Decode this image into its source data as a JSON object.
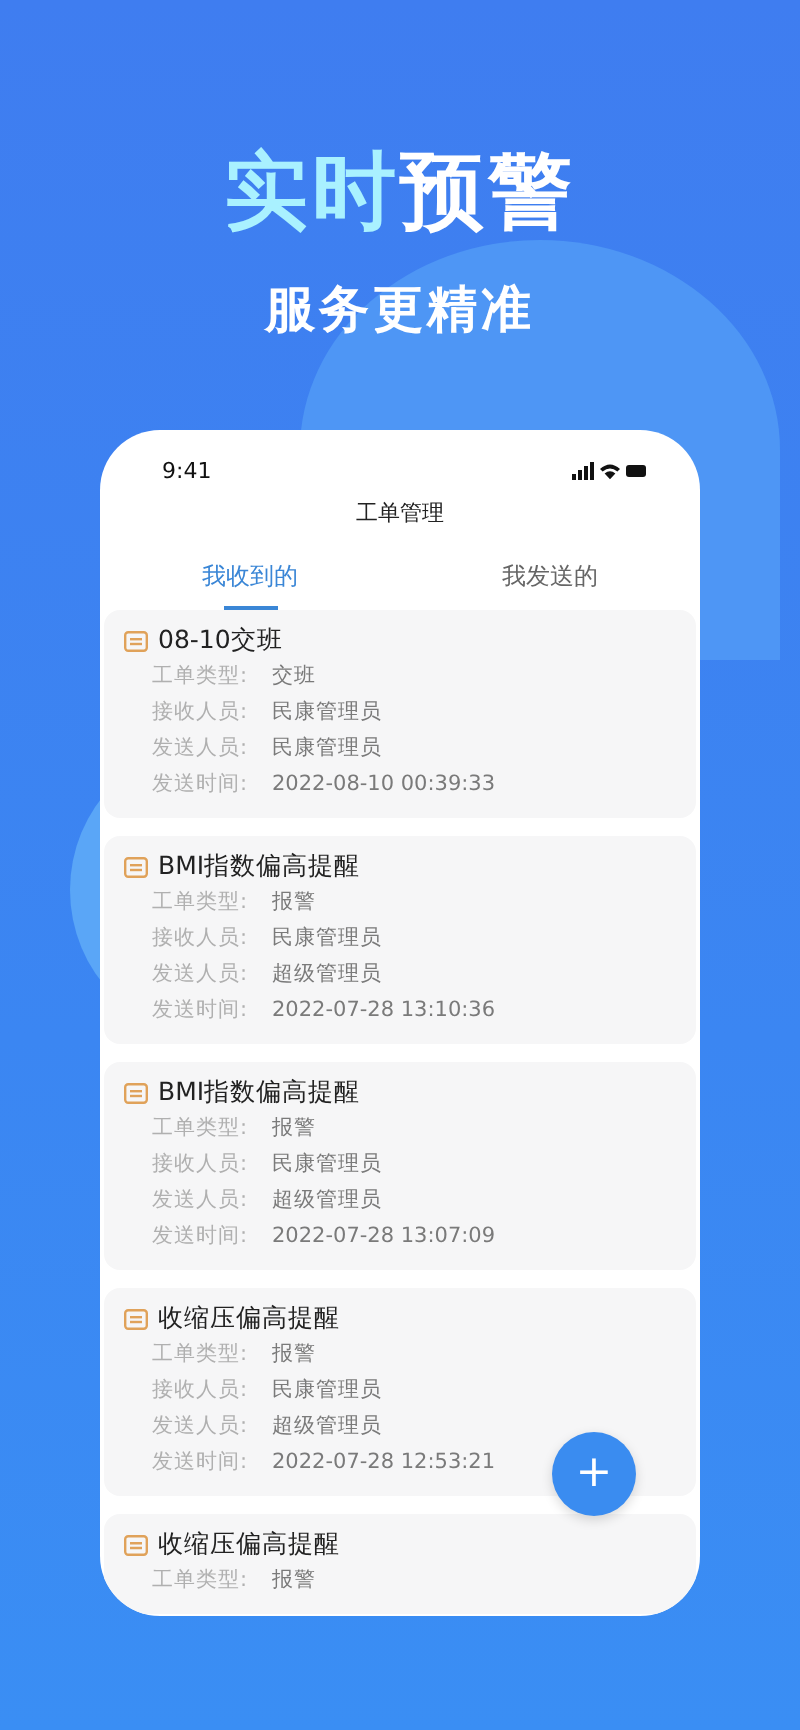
{
  "headline": [
    {
      "text": "实时",
      "kind": "accent"
    },
    {
      "text": "预警",
      "kind": "plain"
    }
  ],
  "subtitle": "服务更精准",
  "phone": {
    "status_time": "9:41",
    "title": "工单管理",
    "tabs": [
      {
        "label": "我收到的",
        "selected": true
      },
      {
        "label": "我发送的",
        "selected": false
      }
    ],
    "cards": [
      {
        "title": "08-10交班",
        "fields": [
          {
            "label": "工单类型:",
            "value": "交班"
          },
          {
            "label": "接收人员:",
            "value": "民康管理员"
          },
          {
            "label": "发送人员:",
            "value": "民康管理员"
          },
          {
            "label": "发送时间:",
            "value": "2022-08-10 00:39:33"
          }
        ]
      },
      {
        "title": "BMI指数偏高提醒",
        "fields": [
          {
            "label": "工单类型:",
            "value": "报警"
          },
          {
            "label": "接收人员:",
            "value": "民康管理员"
          },
          {
            "label": "发送人员:",
            "value": "超级管理员"
          },
          {
            "label": "发送时间:",
            "value": "2022-07-28 13:10:36"
          }
        ]
      },
      {
        "title": "BMI指数偏高提醒",
        "fields": [
          {
            "label": "工单类型:",
            "value": "报警"
          },
          {
            "label": "接收人员:",
            "value": "民康管理员"
          },
          {
            "label": "发送人员:",
            "value": "超级管理员"
          },
          {
            "label": "发送时间:",
            "value": "2022-07-28 13:07:09"
          }
        ]
      },
      {
        "title": "收缩压偏高提醒",
        "fields": [
          {
            "label": "工单类型:",
            "value": "报警"
          },
          {
            "label": "接收人员:",
            "value": "民康管理员"
          },
          {
            "label": "发送人员:",
            "value": "超级管理员"
          },
          {
            "label": "发送时间:",
            "value": "2022-07-28 12:53:21"
          }
        ]
      },
      {
        "title": "收缩压偏高提醒",
        "fields": [
          {
            "label": "工单类型:",
            "value": "报警"
          }
        ]
      }
    ],
    "fab": "+"
  }
}
